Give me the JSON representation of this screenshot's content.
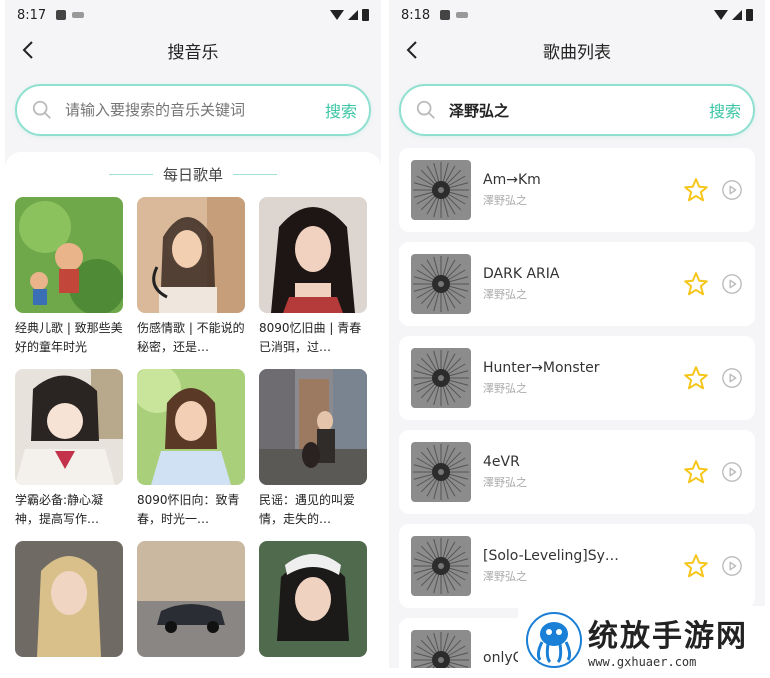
{
  "left_screen": {
    "status": {
      "time": "8:17"
    },
    "header": {
      "title": "搜音乐"
    },
    "search": {
      "placeholder": "请输入要搜索的音乐关键词",
      "button": "搜索"
    },
    "daily": {
      "heading": "每日歌单",
      "playlists": [
        {
          "caption": "经典儿歌 | 致那些美好的童年时光",
          "image": "cartoon-children-lotus"
        },
        {
          "caption": "伤感情歌 | 不能说的秘密，还是…",
          "image": "girl-on-telephone"
        },
        {
          "caption": "8090忆旧曲 | 青春已消弭，过…",
          "image": "woman-portrait-dark-hair"
        },
        {
          "caption": "学霸必备:静心凝神，提高写作…",
          "image": "anime-student-studying"
        },
        {
          "caption": "8090怀旧向：致青春，时光一…",
          "image": "girl-in-sunlight"
        },
        {
          "caption": "民谣：遇见的叫爱情，走失的…",
          "image": "girl-with-guitar-city"
        },
        {
          "caption": "",
          "image": "blonde-woman"
        },
        {
          "caption": "",
          "image": "sports-car"
        },
        {
          "caption": "",
          "image": "woman-with-headband"
        }
      ]
    }
  },
  "right_screen": {
    "status": {
      "time": "8:18"
    },
    "header": {
      "title": "歌曲列表"
    },
    "search": {
      "value": "泽野弘之",
      "button": "搜索"
    },
    "songs": [
      {
        "name": "Am→Km",
        "artist": "澤野弘之"
      },
      {
        "name": "DARK ARIA",
        "artist": "澤野弘之"
      },
      {
        "name": "Hunter→Monster",
        "artist": "澤野弘之"
      },
      {
        "name": "4eVR",
        "artist": "澤野弘之"
      },
      {
        "name": "[Solo-Leveling]Sy…",
        "artist": "澤野弘之"
      },
      {
        "name": "onlyC",
        "artist": ""
      }
    ]
  },
  "watermark": {
    "name": "统放手游网",
    "url": "www.gxhuaer.com"
  },
  "colors": {
    "accent": "#3cc6a6",
    "star": "#f5c518",
    "border": "#8fe0d0"
  }
}
